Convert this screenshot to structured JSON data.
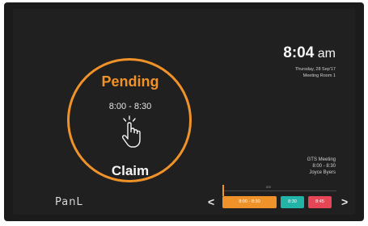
{
  "colors": {
    "accent_orange": "#f0922a",
    "teal": "#22b5a7",
    "red": "#e64656",
    "screen_bg": "#202020"
  },
  "booking": {
    "status": "Pending",
    "time_range": "8:00 - 8:30",
    "action_label": "Claim",
    "action_icon": "tap-hand-icon"
  },
  "clock": {
    "time": "8:04",
    "ampm": "am",
    "date": "Thursday, 28 Sep'17",
    "room": "Meeting Room 1"
  },
  "next_meeting": {
    "title": "GTS Meeting",
    "time": "8:00 - 8:30",
    "organizer": "Joyce Byers"
  },
  "brand": {
    "logo_text": "PanL"
  },
  "timeline": {
    "label": "am",
    "prev_icon": "chevron-left-icon",
    "prev_symbol": "<",
    "next_icon": "chevron-right-icon",
    "next_symbol": ">",
    "slots": [
      {
        "label": "8:00 - 8:30",
        "color": "orange"
      },
      {
        "label": "8:30",
        "color": "teal"
      },
      {
        "label": "8:45",
        "color": "red"
      }
    ]
  }
}
